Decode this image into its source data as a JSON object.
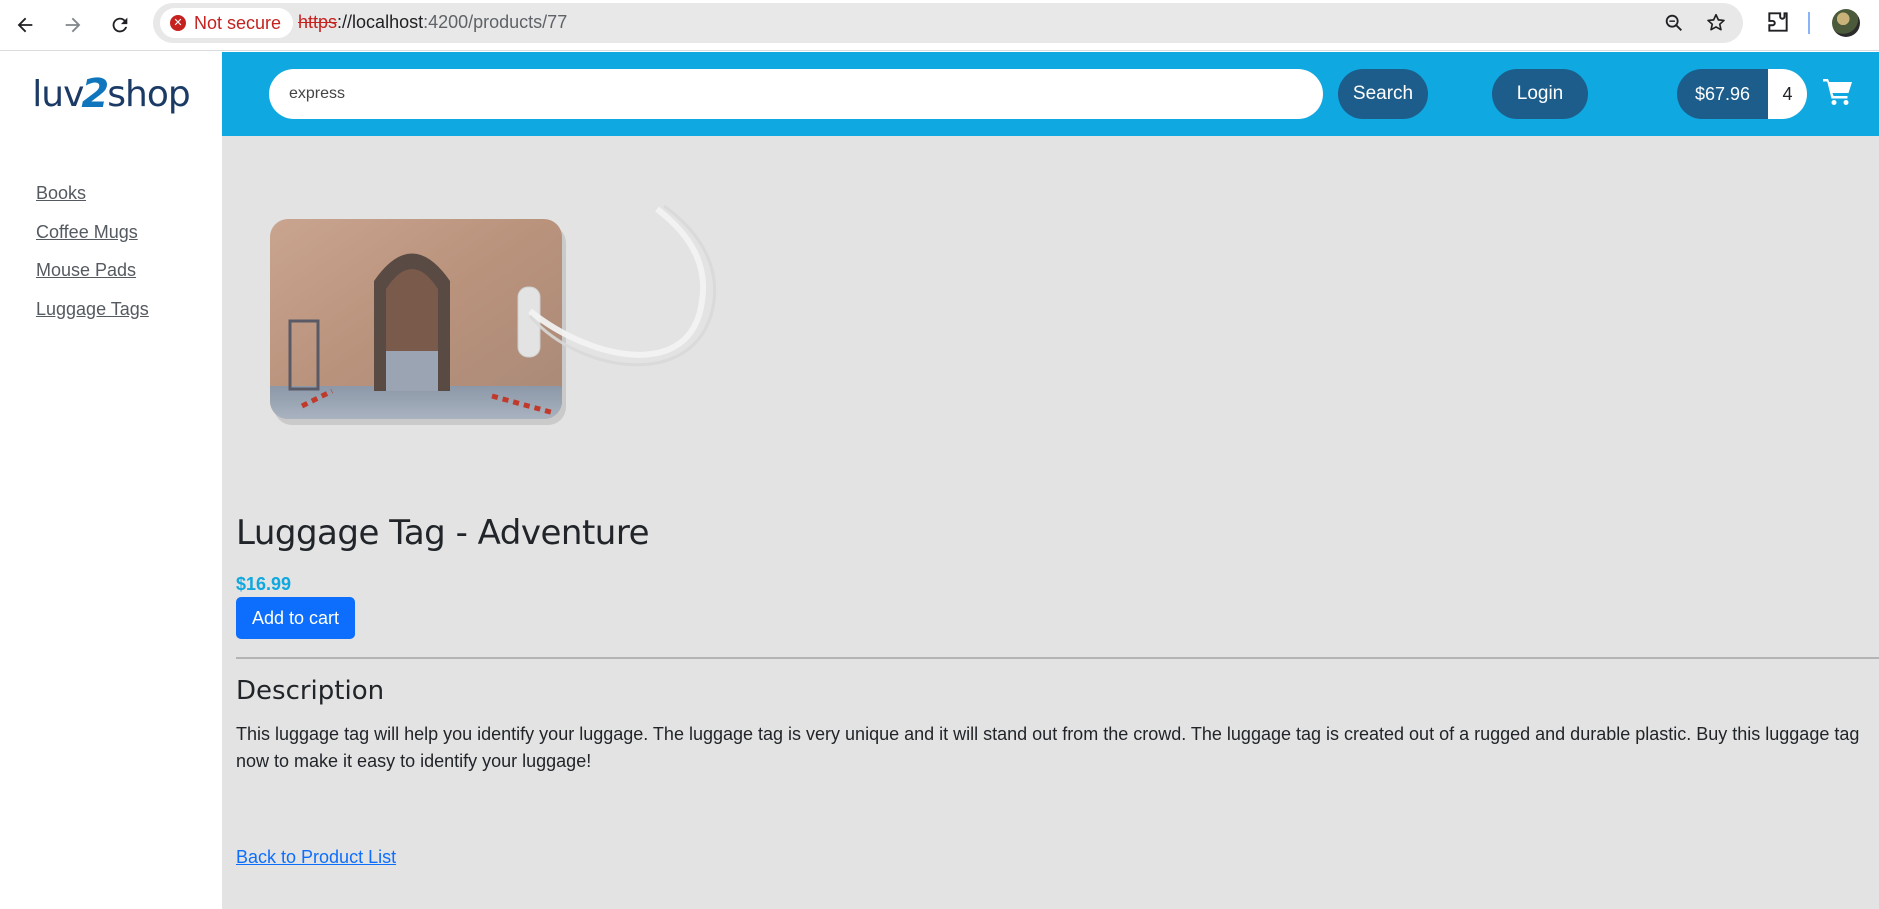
{
  "browser": {
    "security_label": "Not secure",
    "url_scheme": "https",
    "url_sep": "://",
    "url_host": "localhost",
    "url_path": ":4200/products/77"
  },
  "logo": {
    "part1": "luv",
    "part2": "2",
    "part3": "shop"
  },
  "header": {
    "search_value": "express",
    "search_button": "Search",
    "login_button": "Login",
    "cart_total": "$67.96",
    "cart_quantity": "4",
    "colors": {
      "header_bg": "#10a8e0",
      "pill_bg": "#1c5d8c"
    }
  },
  "sidebar": {
    "categories": [
      {
        "label": "Books"
      },
      {
        "label": "Coffee Mugs"
      },
      {
        "label": "Mouse Pads"
      },
      {
        "label": "Luggage Tags"
      }
    ]
  },
  "product": {
    "image_icon": "luggage-tag-photo",
    "name": "Luggage Tag - Adventure",
    "price": "$16.99",
    "add_to_cart": "Add to cart",
    "description_heading": "Description",
    "description": "This luggage tag will help you identify your luggage. The luggage tag is very unique and it will stand out from the crowd. The luggage tag is created out of a rugged and durable plastic. Buy this luggage tag now to make it easy to identify your luggage!",
    "back_link": "Back to Product List"
  }
}
